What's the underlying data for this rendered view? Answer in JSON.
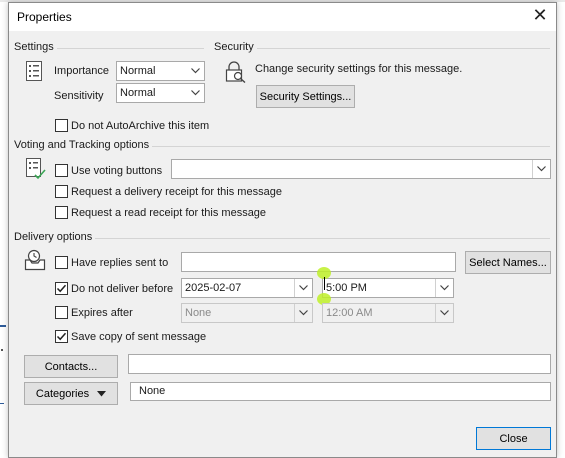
{
  "window": {
    "title": "Properties",
    "close_glyph": "✕"
  },
  "settings": {
    "section_label": "Settings",
    "importance_label": "Importance",
    "importance_value": "Normal",
    "sensitivity_label": "Sensitivity",
    "sensitivity_value": "Normal",
    "no_autoarchive_label": "Do not AutoArchive this item",
    "no_autoarchive_checked": false
  },
  "security": {
    "section_label": "Security",
    "description": "Change security settings for this message.",
    "button_label": "Security Settings..."
  },
  "voting": {
    "section_label": "Voting and Tracking options",
    "use_voting_label": "Use voting buttons",
    "use_voting_value": "",
    "delivery_receipt_label": "Request a delivery receipt for this message",
    "read_receipt_label": "Request a read receipt for this message"
  },
  "delivery": {
    "section_label": "Delivery options",
    "have_replies_label": "Have replies sent to",
    "have_replies_value": "",
    "select_names_label": "Select Names...",
    "do_not_deliver_label": "Do not deliver before",
    "do_not_deliver_checked": true,
    "do_not_deliver_date": "2025-02-07",
    "do_not_deliver_time": "5:00 PM",
    "expires_label": "Expires after",
    "expires_checked": false,
    "expires_date": "None",
    "expires_time": "12:00 AM",
    "save_copy_label": "Save copy of sent message",
    "save_copy_checked": true
  },
  "contacts": {
    "button_label": "Contacts...",
    "value": ""
  },
  "categories": {
    "button_label": "Categories",
    "value": "None"
  },
  "footer": {
    "close_label": "Close"
  },
  "colors": {
    "accent": "#0078d7",
    "dialog_bg": "#f0f0f0",
    "highlight": "#bef028"
  }
}
